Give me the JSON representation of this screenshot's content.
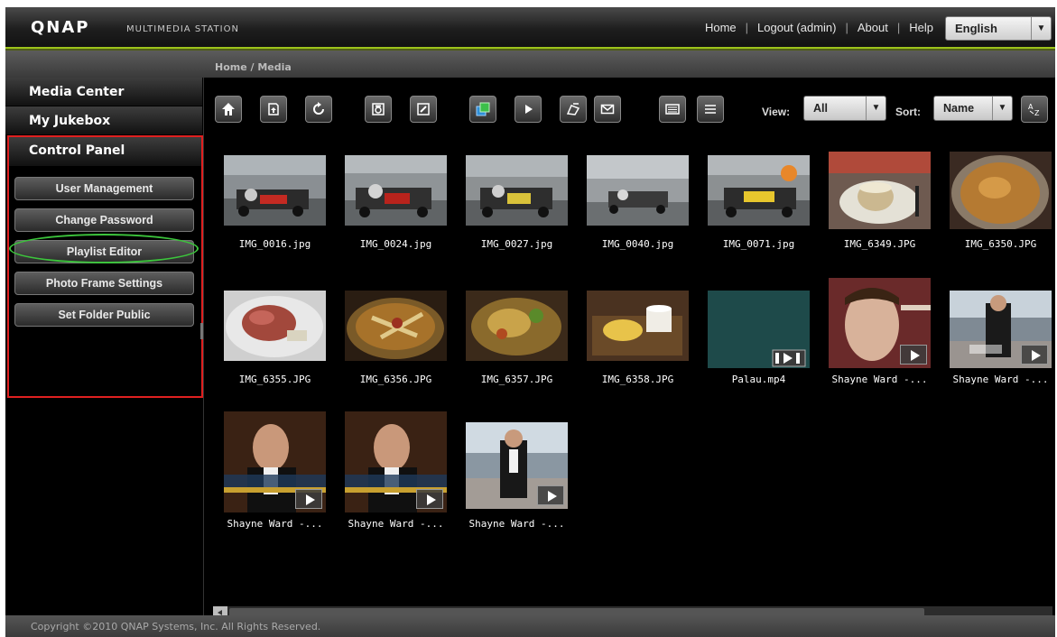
{
  "header": {
    "logo": "QNAP",
    "product": "MULTIMEDIA STATION",
    "links": [
      "Home",
      "Logout (admin)",
      "About",
      "Help"
    ],
    "language": "English"
  },
  "breadcrumb": "Home / Media",
  "sidebar": {
    "items": [
      "Media Center",
      "My Jukebox",
      "Control Panel"
    ],
    "control_panel_buttons": [
      "User Management",
      "Change Password",
      "Playlist Editor",
      "Photo Frame Settings",
      "Set Folder Public"
    ]
  },
  "toolbar": {
    "icons": [
      "home-icon",
      "up-folder-icon",
      "refresh-icon",
      "rotate-icon",
      "edit-icon",
      "slideshow-icon",
      "play-icon",
      "publish-icon",
      "email-icon",
      "thumbnail-view-icon",
      "list-view-icon",
      "sort-az-icon"
    ],
    "view_label": "View:",
    "view_value": "All",
    "sort_label": "Sort:",
    "sort_value": "Name"
  },
  "media": [
    {
      "name": "IMG_0016.jpg",
      "kind": "photo"
    },
    {
      "name": "IMG_0024.jpg",
      "kind": "photo"
    },
    {
      "name": "IMG_0027.jpg",
      "kind": "photo"
    },
    {
      "name": "IMG_0040.jpg",
      "kind": "photo"
    },
    {
      "name": "IMG_0071.jpg",
      "kind": "photo"
    },
    {
      "name": "IMG_6349.JPG",
      "kind": "photo"
    },
    {
      "name": "IMG_6350.JPG",
      "kind": "photo"
    },
    {
      "name": "IMG_6355.JPG",
      "kind": "photo"
    },
    {
      "name": "IMG_6356.JPG",
      "kind": "photo"
    },
    {
      "name": "IMG_6357.JPG",
      "kind": "photo"
    },
    {
      "name": "IMG_6358.JPG",
      "kind": "photo"
    },
    {
      "name": "Palau.mp4",
      "kind": "video"
    },
    {
      "name": "Shayne Ward -...",
      "kind": "video"
    },
    {
      "name": "Shayne Ward -...",
      "kind": "video"
    },
    {
      "name": "Shayne Ward -...",
      "kind": "video"
    },
    {
      "name": "Shayne Ward -...",
      "kind": "video"
    },
    {
      "name": "Shayne Ward -...",
      "kind": "video"
    }
  ],
  "footer": "Copyright ©2010 QNAP Systems, Inc. All Rights Reserved.",
  "colors": {
    "accent": "#9cc31b",
    "highlight_box": "#e02020",
    "highlight_ring": "#3cc43c"
  }
}
